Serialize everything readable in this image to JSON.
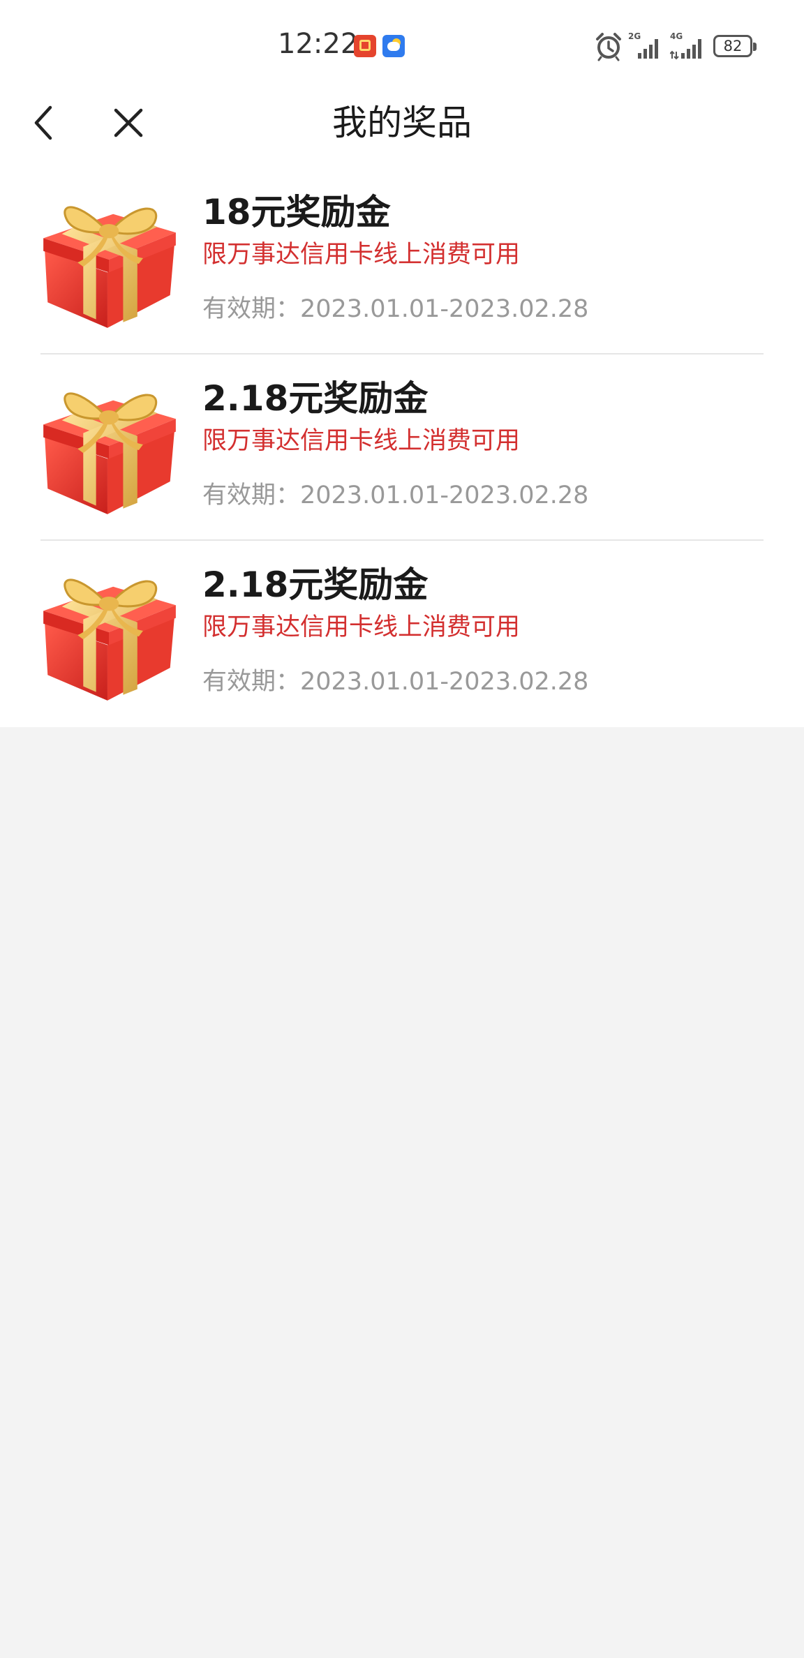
{
  "status_bar": {
    "time": "12:22",
    "notification_icons": [
      "app-notification-icon",
      "weather-icon"
    ],
    "signal_1": "2G",
    "signal_2": "4G",
    "battery": "82"
  },
  "nav": {
    "title": "我的奖品",
    "back_icon": "chevron-left-icon",
    "close_icon": "close-icon"
  },
  "prizes": [
    {
      "title": "18元奖励金",
      "description": "限万事达信用卡线上消费可用",
      "validity": "有效期：2023.01.01-2023.02.28",
      "icon": "gift-box-icon"
    },
    {
      "title": "2.18元奖励金",
      "description": "限万事达信用卡线上消费可用",
      "validity": "有效期：2023.01.01-2023.02.28",
      "icon": "gift-box-icon"
    },
    {
      "title": "2.18元奖励金",
      "description": "限万事达信用卡线上消费可用",
      "validity": "有效期：2023.01.01-2023.02.28",
      "icon": "gift-box-icon"
    }
  ],
  "colors": {
    "accent_red": "#d32f2f",
    "title_text": "#1a1a1a",
    "secondary_text": "#999999",
    "page_background": "#f3f3f3"
  }
}
